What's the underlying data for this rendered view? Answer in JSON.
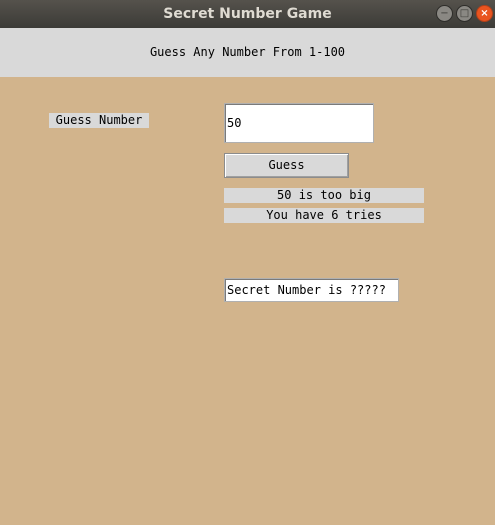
{
  "window": {
    "title": "Secret Number Game",
    "controls": {
      "minimize": "−",
      "maximize": "□",
      "close": "×"
    }
  },
  "header": {
    "instruction": "Guess Any Number From 1-100"
  },
  "form": {
    "guess_label": "Guess Number",
    "guess_value": "50",
    "guess_button": "Guess"
  },
  "status": {
    "feedback": "50 is too big",
    "tries": "You have 6 tries"
  },
  "secret": {
    "value": "Secret Number is ?????"
  },
  "colors": {
    "background": "#d2b48c",
    "header_band": "#d9d9d9",
    "close_button": "#e9541f"
  }
}
